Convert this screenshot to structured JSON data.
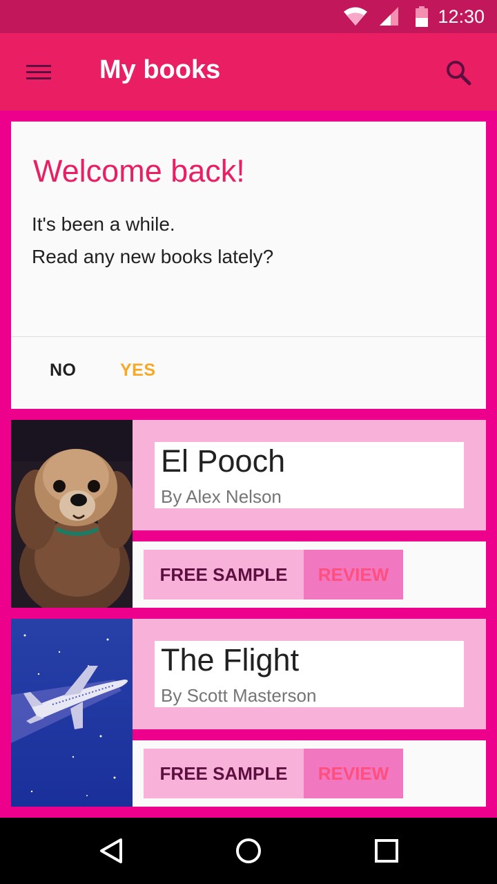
{
  "status_bar": {
    "time": "12:30",
    "icons": [
      "wifi-icon",
      "signal-icon",
      "battery-icon"
    ]
  },
  "app_bar": {
    "title": "My books",
    "menu_icon": "menu-icon",
    "search_icon": "search-icon"
  },
  "welcome_card": {
    "heading": "Welcome back!",
    "line1": "It's been a while.",
    "line2": "Read any new books lately?",
    "no_label": "NO",
    "yes_label": "YES"
  },
  "books": [
    {
      "title": "El Pooch",
      "author": "By Alex Nelson",
      "sample_label": "FREE SAMPLE",
      "review_label": "REVIEW"
    },
    {
      "title": "The Flight",
      "author": "By Scott Masterson",
      "sample_label": "FREE SAMPLE",
      "review_label": "REVIEW"
    }
  ],
  "nav_bar": {
    "icons": [
      "back-icon",
      "home-icon",
      "recents-icon"
    ]
  },
  "colors": {
    "primary": "#e91e63",
    "primary_dark": "#c2185b",
    "background": "#ec008c",
    "accent": "#f9a825",
    "card_pink": "#f8b1d8"
  }
}
